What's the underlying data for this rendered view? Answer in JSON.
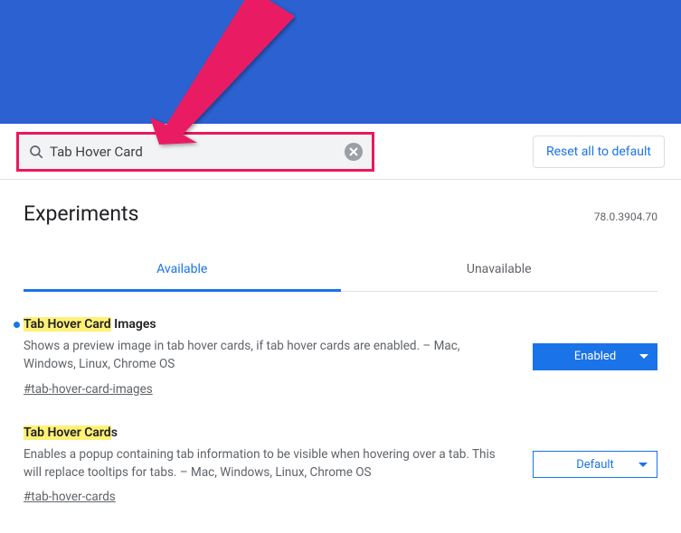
{
  "search": {
    "value": "Tab Hover Card",
    "clear_icon": "clear"
  },
  "reset_label": "Reset all to default",
  "page_title": "Experiments",
  "version": "78.0.3904.70",
  "tabs": {
    "available": "Available",
    "unavailable": "Unavailable"
  },
  "flags": [
    {
      "title_highlight": "Tab Hover Card",
      "title_rest": " Images",
      "desc": "Shows a preview image in tab hover cards, if tab hover cards are enabled. – Mac, Windows, Linux, Chrome OS",
      "hash": "#tab-hover-card-images",
      "select": "Enabled",
      "style": "enabled",
      "modified": true
    },
    {
      "title_highlight": "Tab Hover Card",
      "title_rest": "s",
      "desc": "Enables a popup containing tab information to be visible when hovering over a tab. This will replace tooltips for tabs. – Mac, Windows, Linux, Chrome OS",
      "hash": "#tab-hover-cards",
      "select": "Default",
      "style": "default",
      "modified": false
    }
  ]
}
